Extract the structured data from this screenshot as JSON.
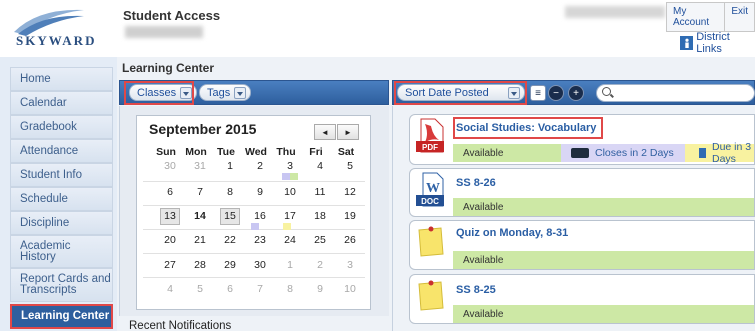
{
  "header": {
    "app_title": "Student Access",
    "brand": "SKYWARD",
    "links": [
      "My Account",
      "Exit"
    ],
    "district_links": "District Links"
  },
  "sidebar": {
    "items": [
      {
        "label": "Home"
      },
      {
        "label": "Calendar"
      },
      {
        "label": "Gradebook"
      },
      {
        "label": "Attendance"
      },
      {
        "label": "Student Info"
      },
      {
        "label": "Schedule"
      },
      {
        "label": "Discipline"
      },
      {
        "label": "Academic History"
      },
      {
        "label": "Report Cards and Transcripts"
      },
      {
        "label": "Learning Center",
        "active": true
      }
    ]
  },
  "main": {
    "title": "Learning Center",
    "classes_label": "Classes",
    "tags_label": "Tags",
    "sort_label": "Sort Date Posted",
    "search_placeholder": "",
    "recent_notifications": "Recent Notifications"
  },
  "calendar": {
    "month_title": "September 2015",
    "prev": "◄",
    "next": "►",
    "days_of_week": [
      "Sun",
      "Mon",
      "Tue",
      "Wed",
      "Thu",
      "Fri",
      "Sat"
    ],
    "weeks": [
      [
        "30",
        "31",
        "1",
        "2",
        "3",
        "4",
        "5"
      ],
      [
        "6",
        "7",
        "8",
        "9",
        "10",
        "11",
        "12"
      ],
      [
        "13",
        "14",
        "15",
        "16",
        "17",
        "18",
        "19"
      ],
      [
        "20",
        "21",
        "22",
        "23",
        "24",
        "25",
        "26"
      ],
      [
        "27",
        "28",
        "29",
        "30",
        "1",
        "2",
        "3"
      ],
      [
        "4",
        "5",
        "6",
        "7",
        "8",
        "9",
        "10"
      ]
    ]
  },
  "assignments": [
    {
      "title": "Social Studies: Vocabulary",
      "type": "PDF",
      "status": "Available",
      "closes": "Closes in 2 Days",
      "due": "Due in 3 Days"
    },
    {
      "title": "SS 8-26",
      "type": "DOC",
      "status": "Available"
    },
    {
      "title": "Quiz on Monday, 8-31",
      "type": "note",
      "status": "Available"
    },
    {
      "title": "SS 8-25",
      "type": "note",
      "status": "Available"
    }
  ],
  "colors": {
    "accent": "#2e5f9e",
    "highlight": "#e04848",
    "available": "#cde8a5",
    "closes": "#d9d6f5",
    "due": "#f8f2a0"
  }
}
